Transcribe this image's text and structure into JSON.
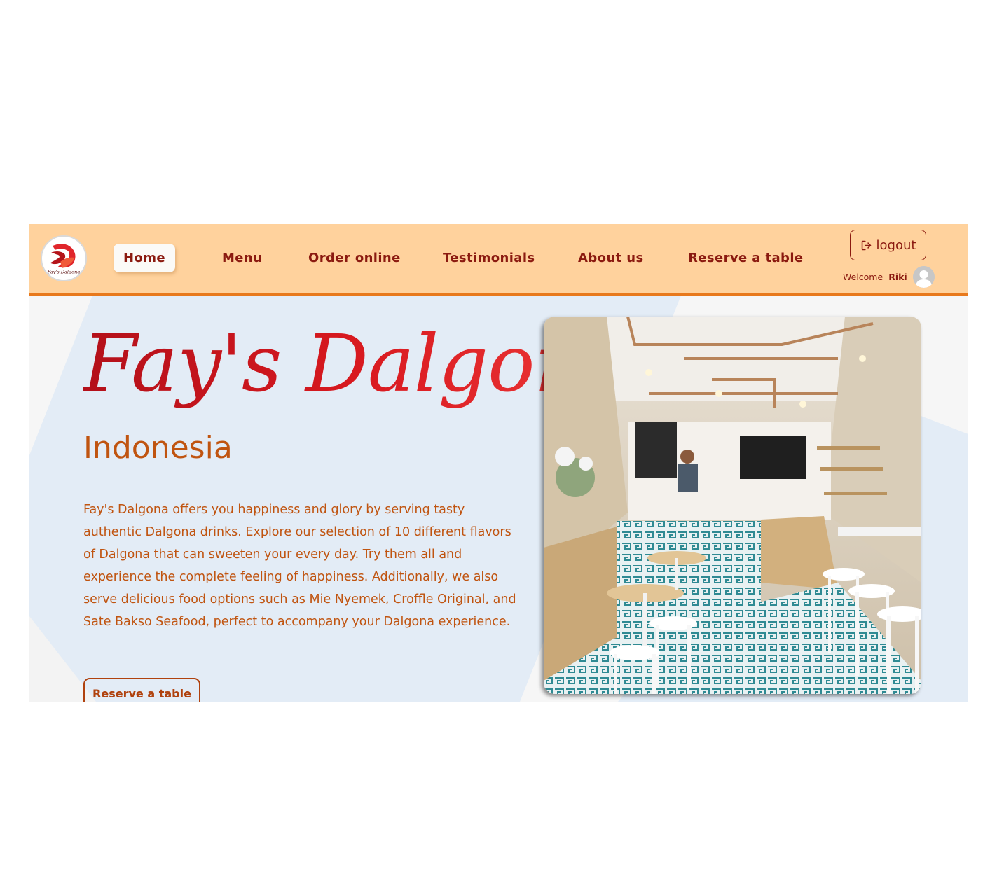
{
  "brand": {
    "logo_text": "Fay's Dalgona",
    "logo_icon": "dalgona-logo-icon"
  },
  "nav": {
    "items": [
      {
        "label": "Home",
        "active": true
      },
      {
        "label": "Menu",
        "active": false
      },
      {
        "label": "Order online",
        "active": false
      },
      {
        "label": "Testimonials",
        "active": false
      },
      {
        "label": "About us",
        "active": false
      },
      {
        "label": "Reserve a table",
        "active": false
      }
    ]
  },
  "user": {
    "logout_label": "logout",
    "logout_icon": "logout-icon",
    "welcome_prefix": "Welcome",
    "name": "Riki",
    "avatar_icon": "user-avatar-icon"
  },
  "hero": {
    "title": "Fay's Dalgona",
    "subtitle": "Indonesia",
    "description": "Fay's Dalgona offers you happiness and glory by serving tasty authentic Dalgona drinks. Explore our selection of 10 different flavors of Dalgona that can sweeten your every day. Try them all and experience the complete feeling of happiness. Additionally, we also serve delicious food options such as Mie Nyemek, Croffle Original, and Sate Bakso Seafood, perfect to accompany your Dalgona experience.",
    "cta_label": "Reserve a table"
  },
  "colors": {
    "nav_bg": "#ffd29d",
    "nav_border": "#e8791c",
    "nav_text": "#8b1a10",
    "hero_bg_shape": "#e3ecf6",
    "title_red": "#d8191f",
    "body_orange": "#c05410"
  }
}
